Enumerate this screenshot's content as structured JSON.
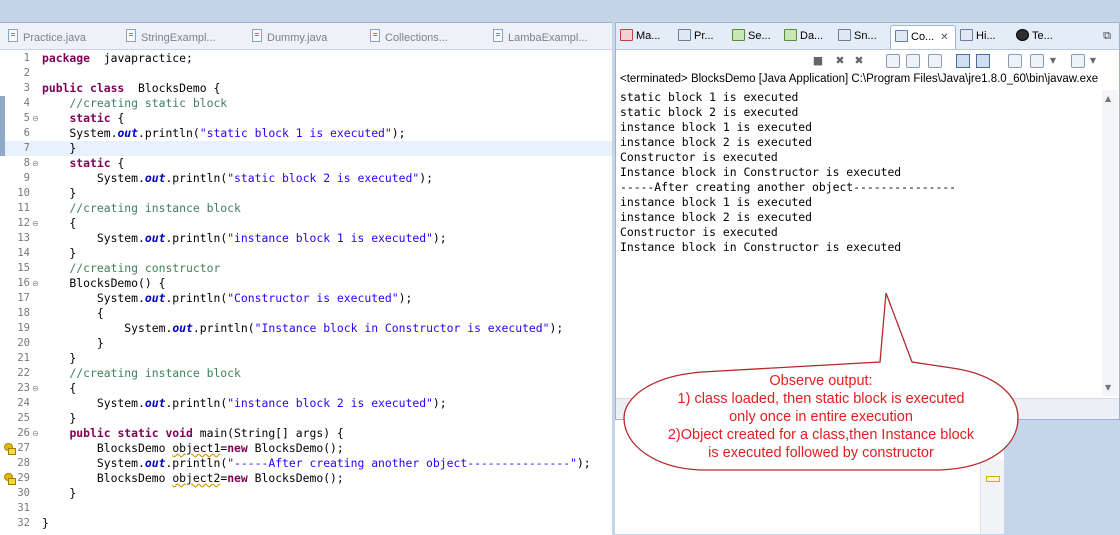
{
  "editor": {
    "tabs": [
      "Practice.java",
      "StringExampl...",
      "Dummy.java",
      "Collections...",
      "LambaExampl..."
    ],
    "lines": [
      {
        "n": "1",
        "parts": [
          [
            "kw",
            "package"
          ],
          [
            "",
            "  javapractice;"
          ]
        ]
      },
      {
        "n": "2",
        "parts": []
      },
      {
        "n": "3",
        "parts": [
          [
            "kw",
            "public class"
          ],
          [
            "",
            "  BlocksDemo {"
          ]
        ]
      },
      {
        "n": "4",
        "parts": [
          [
            "",
            "    "
          ],
          [
            "cm",
            "//creating static block"
          ]
        ],
        "gutter": true
      },
      {
        "n": "5",
        "fold": true,
        "parts": [
          [
            "",
            "    "
          ],
          [
            "kw",
            "static"
          ],
          [
            "",
            " {"
          ]
        ],
        "gutter": true
      },
      {
        "n": "6",
        "parts": [
          [
            "",
            "    System."
          ],
          [
            "it",
            "out"
          ],
          [
            "",
            ".println("
          ],
          [
            "st",
            "\"static block 1 is executed\""
          ],
          [
            "",
            ");"
          ]
        ],
        "gutter": true
      },
      {
        "n": "7",
        "parts": [
          [
            "",
            "    }"
          ]
        ],
        "gutter": true,
        "highlight": true
      },
      {
        "n": "8",
        "fold": true,
        "parts": [
          [
            "",
            "    "
          ],
          [
            "kw",
            "static"
          ],
          [
            "",
            " {"
          ]
        ]
      },
      {
        "n": "9",
        "parts": [
          [
            "",
            "        System."
          ],
          [
            "it",
            "out"
          ],
          [
            "",
            ".println("
          ],
          [
            "st",
            "\"static block 2 is executed\""
          ],
          [
            "",
            ");"
          ]
        ]
      },
      {
        "n": "10",
        "parts": [
          [
            "",
            "    }"
          ]
        ]
      },
      {
        "n": "11",
        "parts": [
          [
            "",
            "    "
          ],
          [
            "cm",
            "//creating instance block"
          ]
        ]
      },
      {
        "n": "12",
        "fold": true,
        "parts": [
          [
            "",
            "    {"
          ]
        ]
      },
      {
        "n": "13",
        "parts": [
          [
            "",
            "        System."
          ],
          [
            "it",
            "out"
          ],
          [
            "",
            ".println("
          ],
          [
            "st",
            "\"instance block 1 is executed\""
          ],
          [
            "",
            ");"
          ]
        ]
      },
      {
        "n": "14",
        "parts": [
          [
            "",
            "    }"
          ]
        ]
      },
      {
        "n": "15",
        "parts": [
          [
            "",
            "    "
          ],
          [
            "cm",
            "//creating constructor"
          ]
        ]
      },
      {
        "n": "16",
        "fold": true,
        "parts": [
          [
            "",
            "    BlocksDemo() {"
          ]
        ]
      },
      {
        "n": "17",
        "parts": [
          [
            "",
            "        System."
          ],
          [
            "it",
            "out"
          ],
          [
            "",
            ".println("
          ],
          [
            "st",
            "\"Constructor is executed\""
          ],
          [
            "",
            ");"
          ]
        ]
      },
      {
        "n": "18",
        "parts": [
          [
            "",
            "        {"
          ]
        ]
      },
      {
        "n": "19",
        "parts": [
          [
            "",
            "            System."
          ],
          [
            "it",
            "out"
          ],
          [
            "",
            ".println("
          ],
          [
            "st",
            "\"Instance block in Constructor is executed\""
          ],
          [
            "",
            ");"
          ]
        ]
      },
      {
        "n": "20",
        "parts": [
          [
            "",
            "        }"
          ]
        ]
      },
      {
        "n": "21",
        "parts": [
          [
            "",
            "    }"
          ]
        ]
      },
      {
        "n": "22",
        "parts": [
          [
            "",
            "    "
          ],
          [
            "cm",
            "//creating instance block"
          ]
        ]
      },
      {
        "n": "23",
        "fold": true,
        "parts": [
          [
            "",
            "    {"
          ]
        ]
      },
      {
        "n": "24",
        "parts": [
          [
            "",
            "        System."
          ],
          [
            "it",
            "out"
          ],
          [
            "",
            ".println("
          ],
          [
            "st",
            "\"instance block 2 is executed\""
          ],
          [
            "",
            ");"
          ]
        ]
      },
      {
        "n": "25",
        "parts": [
          [
            "",
            "    }"
          ]
        ]
      },
      {
        "n": "26",
        "fold": true,
        "parts": [
          [
            "",
            "    "
          ],
          [
            "kw",
            "public static void"
          ],
          [
            "",
            " main(String[] args) {"
          ]
        ]
      },
      {
        "n": "27",
        "warn": true,
        "parts": [
          [
            "",
            "        BlocksDemo "
          ],
          [
            "ul",
            "object1"
          ],
          [
            "",
            "="
          ],
          [
            "kw",
            "new"
          ],
          [
            "",
            " BlocksDemo();"
          ]
        ]
      },
      {
        "n": "28",
        "parts": [
          [
            "",
            "        System."
          ],
          [
            "it",
            "out"
          ],
          [
            "",
            ".println("
          ],
          [
            "st",
            "\"-----After creating another object---------------\""
          ],
          [
            "",
            ");"
          ]
        ]
      },
      {
        "n": "29",
        "warn": true,
        "parts": [
          [
            "",
            "        BlocksDemo "
          ],
          [
            "ul",
            "object2"
          ],
          [
            "",
            "="
          ],
          [
            "kw",
            "new"
          ],
          [
            "",
            " BlocksDemo();"
          ]
        ]
      },
      {
        "n": "30",
        "parts": [
          [
            "",
            "    }"
          ]
        ]
      },
      {
        "n": "31",
        "parts": []
      },
      {
        "n": "32",
        "parts": [
          [
            "",
            "}"
          ]
        ]
      }
    ]
  },
  "views": {
    "tabs": [
      {
        "label": "Ma...",
        "icon": "markers-icon",
        "style": "red"
      },
      {
        "label": "Pr...",
        "icon": "properties-icon",
        "style": ""
      },
      {
        "label": "Se...",
        "icon": "servers-icon",
        "style": "green"
      },
      {
        "label": "Da...",
        "icon": "data-source-icon",
        "style": "green"
      },
      {
        "label": "Sn...",
        "icon": "snippets-icon",
        "style": ""
      },
      {
        "label": "Co...",
        "icon": "console-icon",
        "style": "",
        "active": true
      },
      {
        "label": "Hi...",
        "icon": "history-icon",
        "style": ""
      },
      {
        "label": "Te...",
        "icon": "terminal-icon",
        "style": "dk"
      }
    ]
  },
  "console": {
    "terminated": "<terminated> BlocksDemo [Java Application] C:\\Program Files\\Java\\jre1.8.0_60\\bin\\javaw.exe",
    "lines": [
      "static block 1 is executed",
      "static block 2 is executed",
      "instance block 1 is executed",
      "instance block 2 is executed",
      "Constructor is executed",
      "Instance block in Constructor is executed",
      "-----After creating another object---------------",
      "instance block 1 is executed",
      "instance block 2 is executed",
      "Constructor is executed",
      "Instance block in Constructor is executed"
    ]
  },
  "callout": {
    "lines": [
      "Observe output:",
      "1) class loaded, then static block is executed",
      "only once in entire execution",
      "2)Object created for a class,then Instance block",
      "is executed followed by constructor"
    ],
    "color": "#e02020"
  }
}
